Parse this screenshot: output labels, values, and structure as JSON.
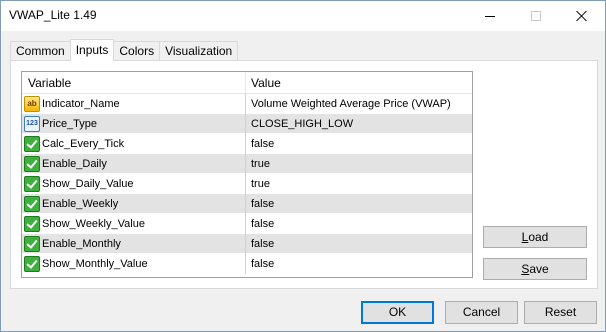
{
  "window": {
    "title": "VWAP_Lite 1.49"
  },
  "tabs": [
    {
      "label": "Common"
    },
    {
      "label": "Inputs"
    },
    {
      "label": "Colors"
    },
    {
      "label": "Visualization"
    }
  ],
  "grid": {
    "col_variable": "Variable",
    "col_value": "Value",
    "rows": [
      {
        "icon": "ab",
        "icon_name": "string-icon",
        "name": "Indicator_Name",
        "value": "Volume Weighted Average Price (VWAP)"
      },
      {
        "icon": "123",
        "icon_name": "enum-icon",
        "name": "Price_Type",
        "value": "CLOSE_HIGH_LOW"
      },
      {
        "icon": "bool",
        "icon_name": "boolean-icon",
        "name": "Calc_Every_Tick",
        "value": "false"
      },
      {
        "icon": "bool",
        "icon_name": "boolean-icon",
        "name": "Enable_Daily",
        "value": "true"
      },
      {
        "icon": "bool",
        "icon_name": "boolean-icon",
        "name": "Show_Daily_Value",
        "value": "true"
      },
      {
        "icon": "bool",
        "icon_name": "boolean-icon",
        "name": "Enable_Weekly",
        "value": "false"
      },
      {
        "icon": "bool",
        "icon_name": "boolean-icon",
        "name": "Show_Weekly_Value",
        "value": "false"
      },
      {
        "icon": "bool",
        "icon_name": "boolean-icon",
        "name": "Enable_Monthly",
        "value": "false"
      },
      {
        "icon": "bool",
        "icon_name": "boolean-icon",
        "name": "Show_Monthly_Value",
        "value": "false"
      }
    ]
  },
  "buttons": {
    "load_first": "L",
    "load_rest": "oad",
    "save_first": "S",
    "save_rest": "ave",
    "ok": "OK",
    "cancel": "Cancel",
    "reset": "Reset"
  },
  "colors": {
    "accent": "#0078d7",
    "row_alt": "#e3e3e3"
  }
}
